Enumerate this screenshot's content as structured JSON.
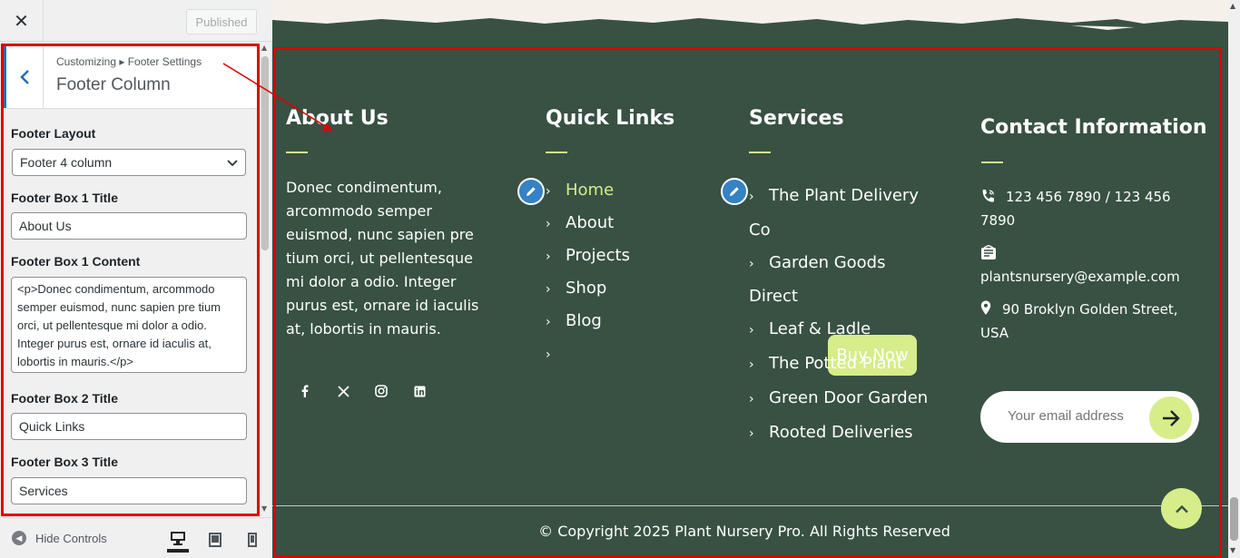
{
  "customizer": {
    "close_label": "✕",
    "published_label": "Published",
    "breadcrumb": "Customizing ▸ Footer Settings",
    "section_title": "Footer Column",
    "controls": [
      {
        "label": "Footer Layout",
        "type": "select",
        "value": "Footer 4 column"
      },
      {
        "label": "Footer Box 1 Title",
        "type": "text",
        "value": "About Us"
      },
      {
        "label": "Footer Box 1 Content",
        "type": "textarea",
        "value": "<p>Donec condimentum, arcommodo semper euismod, nunc sapien pre tium orci, ut pellentesque mi dolor a odio. Integer purus est, ornare id iaculis at, lobortis in mauris.</p>"
      },
      {
        "label": "Footer Box 2 Title",
        "type": "text",
        "value": "Quick Links"
      },
      {
        "label": "Footer Box 3 Title",
        "type": "text",
        "value": "Services"
      }
    ],
    "hide_controls_label": "Hide Controls",
    "devices": [
      "desktop",
      "tablet",
      "mobile"
    ],
    "active_device": "desktop"
  },
  "footer": {
    "about": {
      "title": "About Us",
      "text": "Donec condimentum, arcommodo semper euismod, nunc sapien pre tium orci, ut pellentesque mi dolor a odio. Integer purus est, ornare id iaculis at, lobortis in mauris.",
      "socials": [
        "facebook-icon",
        "x-twitter-icon",
        "instagram-icon",
        "linkedin-icon"
      ]
    },
    "quick_links": {
      "title": "Quick Links",
      "items": [
        "Home",
        "About",
        "Projects",
        "Shop",
        "Blog"
      ],
      "button": "Buy Now"
    },
    "services": {
      "title": "Services",
      "items": [
        "The Plant Delivery Co",
        "Garden Goods Direct",
        "Leaf & Ladle",
        "The Potted Plant",
        "Green Door Garden",
        "Rooted Deliveries"
      ]
    },
    "contact": {
      "title": "Contact Information",
      "phone": "123 456 7890 / 123 456 7890",
      "email": "plantsnursery@example.com",
      "address": "90 Broklyn Golden Street, USA",
      "email_placeholder": "Your email address"
    },
    "copyright": "© Copyright 2025 Plant Nursery Pro. All Rights Reserved"
  },
  "colors": {
    "footer_bg": "#385143",
    "accent": "#d6ed8a",
    "highlight_frame": "#e00000",
    "wp_blue": "#2271b1"
  }
}
